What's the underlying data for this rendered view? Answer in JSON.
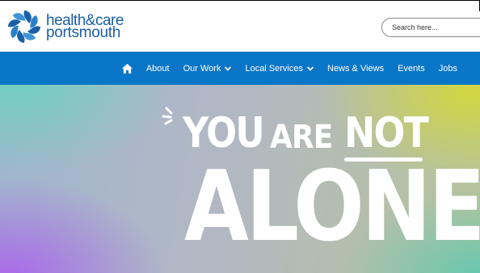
{
  "header": {
    "logo": {
      "line1": "health&care",
      "line2": "portsmouth"
    },
    "search": {
      "placeholder": "Search here..."
    }
  },
  "nav": {
    "items": [
      {
        "label": "About"
      },
      {
        "label": "Our Work"
      },
      {
        "label": "Local Services"
      },
      {
        "label": "News & Views"
      },
      {
        "label": "Events"
      },
      {
        "label": "Jobs"
      }
    ]
  },
  "hero": {
    "line1_you": "YOU",
    "line1_are": "ARE",
    "line1_not": "NOT",
    "line2": "ALONE"
  },
  "colors": {
    "brand_blue": "#1b5fa8",
    "nav_blue": "#0a76c7"
  }
}
